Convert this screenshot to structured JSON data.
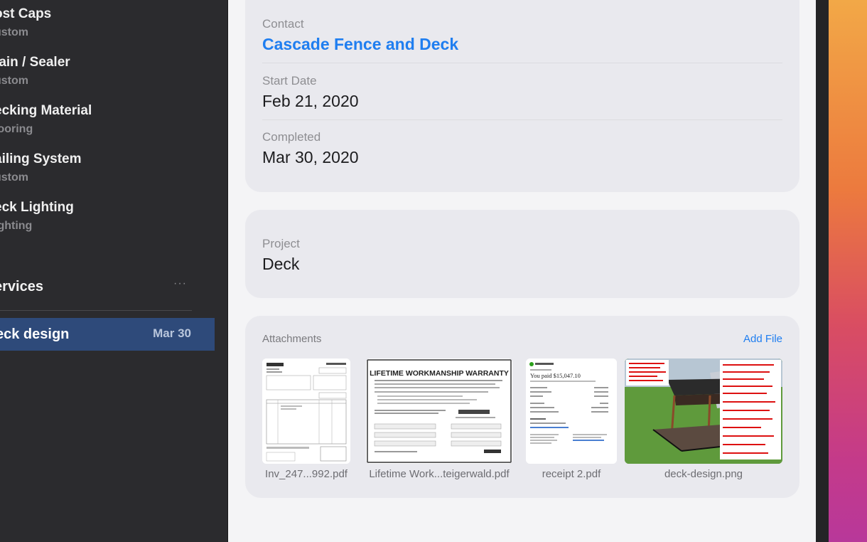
{
  "sidebar": {
    "items": [
      {
        "title": "ost Caps",
        "sub": "ustom"
      },
      {
        "title": "tain / Sealer",
        "sub": "ustom"
      },
      {
        "title": "ecking Material",
        "sub": "looring"
      },
      {
        "title": "ailing System",
        "sub": "ustom"
      },
      {
        "title": "eck Lighting",
        "sub": "ighting"
      }
    ],
    "section": {
      "title": "ervices",
      "more": "···"
    },
    "selected": {
      "name": "eck design",
      "date": "Mar 30"
    }
  },
  "details": {
    "contact_label": "Contact",
    "contact_value": "Cascade Fence and Deck",
    "start_label": "Start Date",
    "start_value": "Feb 21, 2020",
    "completed_label": "Completed",
    "completed_value": "Mar 30, 2020"
  },
  "project": {
    "label": "Project",
    "value": "Deck"
  },
  "attachments": {
    "title": "Attachments",
    "add_label": "Add File",
    "files": [
      {
        "name": "Inv_247...992.pdf"
      },
      {
        "name": "Lifetime Work...teigerwald.pdf",
        "heading": "LIFETIME WORKMANSHIP WARRANTY"
      },
      {
        "name": "receipt 2.pdf",
        "heading": "You paid $15,047.10"
      },
      {
        "name": "deck-design.png"
      }
    ]
  },
  "colors": {
    "accent": "#1f7ef0",
    "selection": "#2e4a7a"
  }
}
